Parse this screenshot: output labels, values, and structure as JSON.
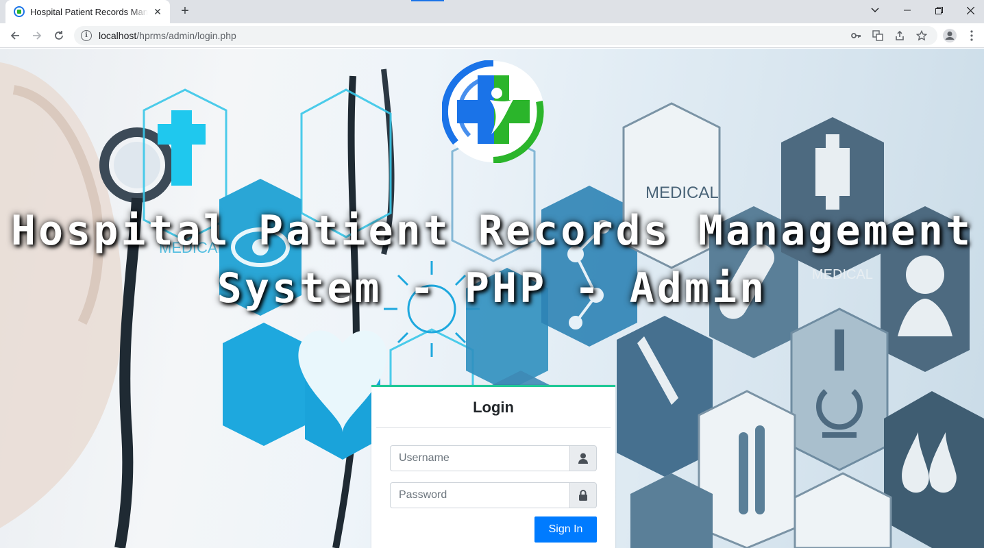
{
  "browser": {
    "tab_title": "Hospital Patient Records Management System - PHP - Admin",
    "url_host": "localhost",
    "url_path": "/hprms/admin/login.php"
  },
  "page": {
    "headline_line1": "Hospital Patient Records Management",
    "headline_line2": "System - PHP - Admin",
    "background_labels": {
      "medical_1": "MEDICAL",
      "medical_2": "MEDICAL",
      "medical_3": "MEDICAL"
    }
  },
  "login": {
    "title": "Login",
    "username_placeholder": "Username",
    "password_placeholder": "Password",
    "signin_label": "Sign In"
  },
  "colors": {
    "accent": "#007bff",
    "card_top_border": "#20c997",
    "logo_blue": "#1a73e8",
    "logo_green": "#2bb52b"
  },
  "icons": {
    "username_addon": "user-icon",
    "password_addon": "lock-icon"
  }
}
